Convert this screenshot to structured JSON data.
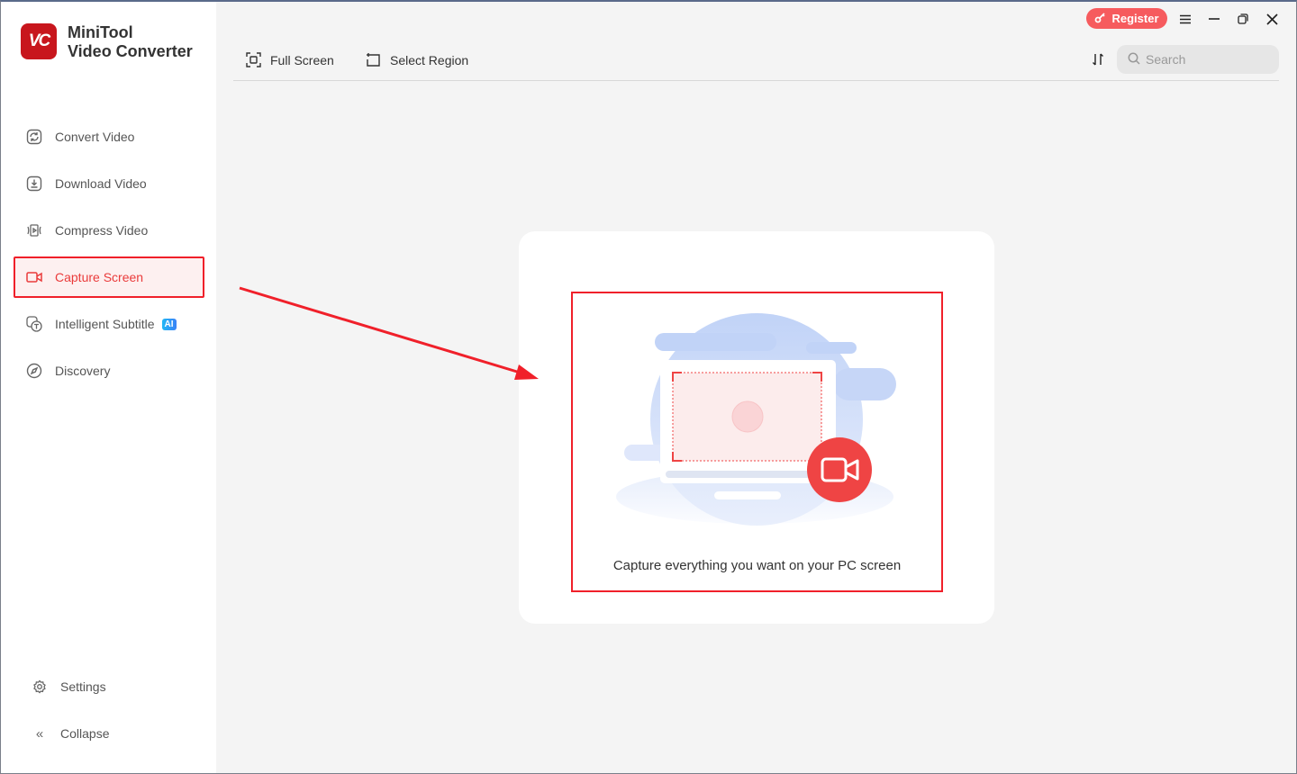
{
  "app": {
    "logo_text": "VC",
    "name_line1": "MiniTool",
    "name_line2": "Video Converter"
  },
  "sidebar": {
    "items": [
      {
        "label": "Convert Video",
        "icon": "convert-icon"
      },
      {
        "label": "Download Video",
        "icon": "download-icon"
      },
      {
        "label": "Compress Video",
        "icon": "compress-icon"
      },
      {
        "label": "Capture Screen",
        "icon": "camera-icon",
        "active": true
      },
      {
        "label": "Intelligent Subtitle",
        "icon": "subtitle-icon",
        "badge": "AI"
      },
      {
        "label": "Discovery",
        "icon": "compass-icon"
      }
    ],
    "settings": "Settings",
    "collapse": "Collapse"
  },
  "toolbar": {
    "full_screen": "Full Screen",
    "select_region": "Select Region"
  },
  "titlebar": {
    "register": "Register"
  },
  "search": {
    "placeholder": "Search"
  },
  "main": {
    "caption": "Capture everything you want on your PC screen"
  },
  "colors": {
    "accent": "#ea3b3b",
    "highlight": "#f0202a",
    "register": "#f65b5e"
  }
}
